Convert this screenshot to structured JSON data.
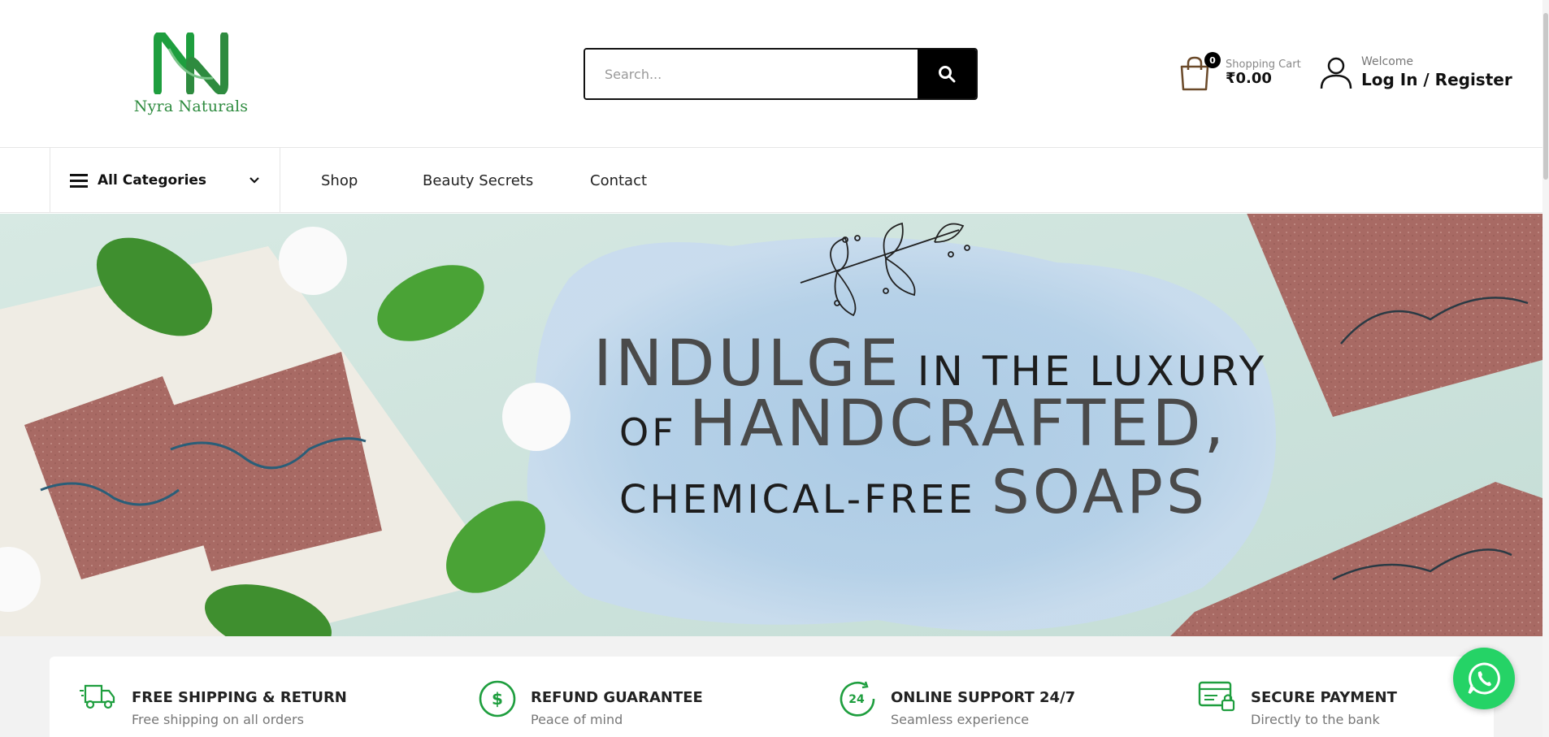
{
  "brand": {
    "name": "Nyra Naturals",
    "color": "#2e8b3f"
  },
  "search": {
    "placeholder": "Search..."
  },
  "cart": {
    "count": "0",
    "label": "Shopping Cart",
    "total": "₹0.00"
  },
  "account": {
    "welcome": "Welcome",
    "login": "Log In / Register"
  },
  "nav": {
    "categories_label": "All Categories",
    "links": [
      "Shop",
      "Beauty Secrets",
      "Contact"
    ]
  },
  "banner": {
    "line1_big": "INDULGE",
    "line1_small": "IN THE LUXURY",
    "line2_small": "OF",
    "line2_big": "HANDCRAFTED,",
    "line3_small": "CHEMICAL-FREE",
    "line3_big": "SOAPS"
  },
  "features": [
    {
      "title": "FREE SHIPPING & RETURN",
      "subtitle": "Free shipping on all orders",
      "icon": "truck-icon"
    },
    {
      "title": "REFUND GUARANTEE",
      "subtitle": "Peace of mind",
      "icon": "dollar-circle-icon"
    },
    {
      "title": "ONLINE SUPPORT 24/7",
      "subtitle": "Seamless experience",
      "icon": "support-24-icon"
    },
    {
      "title": "SECURE PAYMENT",
      "subtitle": "Directly to the bank",
      "icon": "secure-card-icon"
    }
  ],
  "colors": {
    "accent": "#1e9e3e",
    "whatsapp": "#25d366",
    "dark": "#111111"
  }
}
